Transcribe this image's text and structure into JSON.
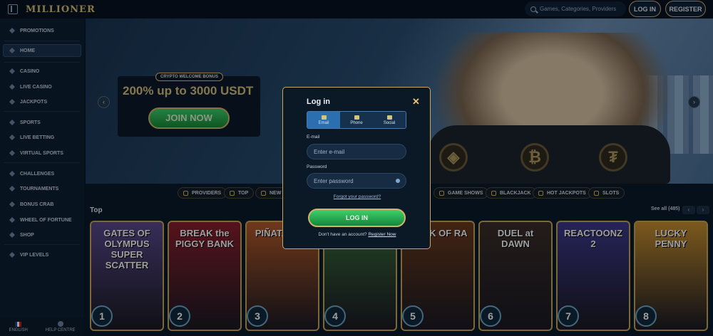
{
  "header": {
    "logo": "MILLIONER",
    "search_placeholder": "Games, Categories, Providers",
    "login_label": "LOG IN",
    "register_label": "REGISTER"
  },
  "sidebar": {
    "items": [
      {
        "label": "PROMOTIONS",
        "icon": "megaphone-icon"
      },
      {
        "label": "HOME",
        "icon": "home-icon",
        "active": true
      },
      {
        "label": "CASINO",
        "icon": "casino-icon"
      },
      {
        "label": "LIVE CASINO",
        "icon": "live-casino-icon"
      },
      {
        "label": "JACKPOTS",
        "icon": "jackpot-icon"
      },
      {
        "label": "SPORTS",
        "icon": "sports-icon"
      },
      {
        "label": "LIVE BETTING",
        "icon": "live-betting-icon"
      },
      {
        "label": "VIRTUAL SPORTS",
        "icon": "virtual-sports-icon"
      },
      {
        "label": "CHALLENGES",
        "icon": "challenges-icon"
      },
      {
        "label": "TOURNAMENTS",
        "icon": "trophy-icon"
      },
      {
        "label": "BONUS CRAB",
        "icon": "crab-icon"
      },
      {
        "label": "WHEEL OF FORTUNE",
        "icon": "wheel-icon"
      },
      {
        "label": "SHOP",
        "icon": "shop-icon"
      },
      {
        "label": "VIP LEVELS",
        "icon": "vip-icon"
      }
    ],
    "footer": {
      "language": "ENGLISH",
      "help": "HELP CENTRE"
    }
  },
  "banner": {
    "tag": "CRYPTO WELCOME BONUS",
    "title": "200% up to 3000 USDT",
    "cta": "JOIN NOW"
  },
  "categories": [
    "PROVIDERS",
    "TOP",
    "NEW",
    "GAME SHOWS",
    "BLACKJACK",
    "HOT JACKPOTS",
    "SLOTS"
  ],
  "top_section": {
    "title": "Top",
    "see_all": "See all (485)"
  },
  "games": [
    {
      "title": "GATES OF OLYMPUS SUPER SCATTER",
      "rank": "1",
      "color": "#5a4a8e"
    },
    {
      "title": "BREAK the PIGGY BANK",
      "rank": "2",
      "color": "#8a1f2e"
    },
    {
      "title": "PIÑATA Fest",
      "rank": "3",
      "color": "#b55a2a"
    },
    {
      "title": "",
      "rank": "4",
      "color": "#3b6e3a"
    },
    {
      "title": "BOOK OF RA",
      "rank": "5",
      "color": "#6b3a1e"
    },
    {
      "title": "DUEL at DAWN",
      "rank": "6",
      "color": "#3a2e2a"
    },
    {
      "title": "REACTOONZ 2",
      "rank": "7",
      "color": "#3e3a8e"
    },
    {
      "title": "LUCKY PENNY",
      "rank": "8",
      "color": "#c89030"
    }
  ],
  "modal": {
    "title": "Log in",
    "tabs": [
      "Email",
      "Phone",
      "Social"
    ],
    "email_label": "E-mail",
    "email_placeholder": "Enter e-mail",
    "password_label": "Password",
    "password_placeholder": "Enter password",
    "forgot": "Forgot your password?",
    "login_button": "LOG IN",
    "no_account": "Don't have an account?",
    "register_link": "Register Now"
  }
}
